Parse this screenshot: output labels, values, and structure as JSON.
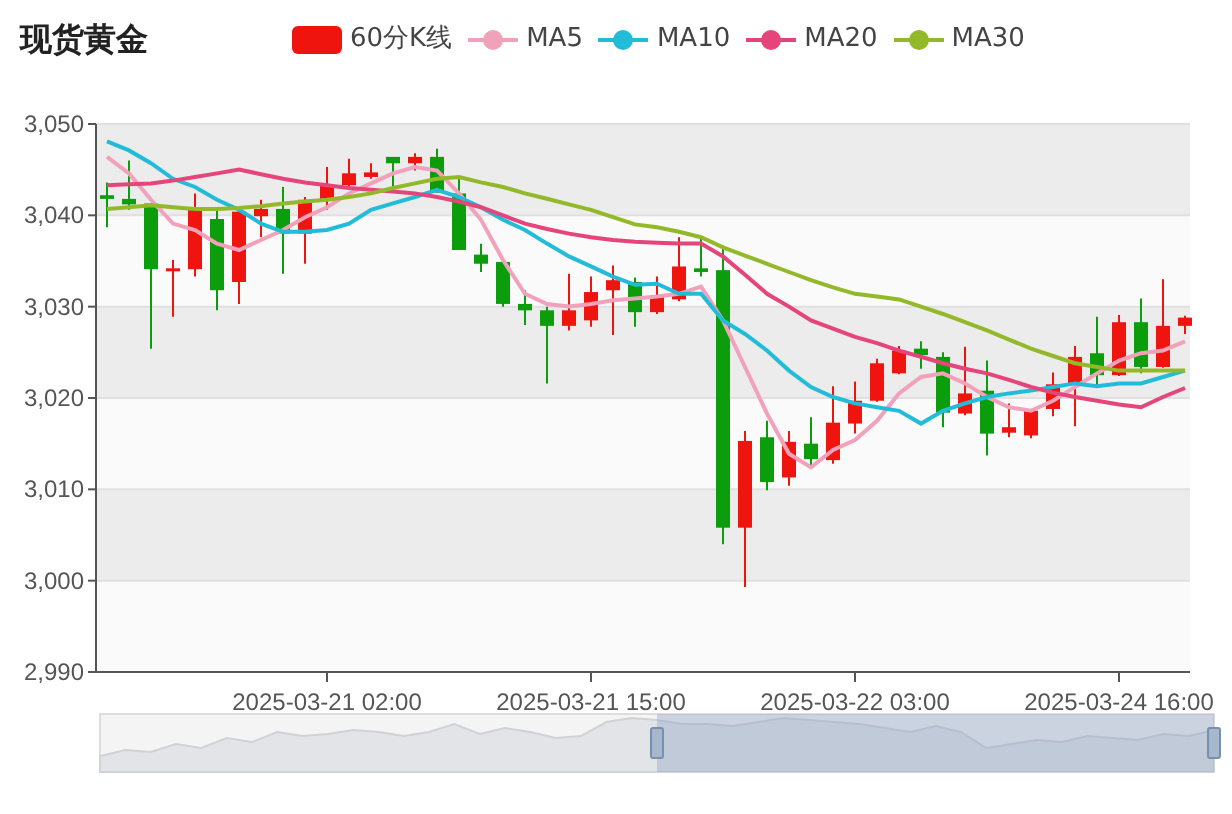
{
  "title": "现货黄金",
  "chart_data": {
    "type": "candlestick",
    "grid": true,
    "ylim": [
      2990,
      3050
    ],
    "yticks": [
      {
        "value": 2990,
        "label": "2,990"
      },
      {
        "value": 3000,
        "label": "3,000"
      },
      {
        "value": 3010,
        "label": "3,010"
      },
      {
        "value": 3020,
        "label": "3,020"
      },
      {
        "value": 3030,
        "label": "3,030"
      },
      {
        "value": 3040,
        "label": "3,040"
      },
      {
        "value": 3050,
        "label": "3,050"
      }
    ],
    "categories": [
      null,
      null,
      null,
      null,
      null,
      null,
      null,
      null,
      null,
      null,
      "2025-03-21 02:00",
      null,
      null,
      null,
      null,
      null,
      null,
      null,
      null,
      null,
      null,
      null,
      "2025-03-21 15:00",
      null,
      null,
      null,
      null,
      null,
      null,
      null,
      null,
      null,
      null,
      null,
      "2025-03-22 03:00",
      null,
      null,
      null,
      null,
      null,
      null,
      null,
      null,
      null,
      null,
      null,
      "2025-03-24 16:00",
      null,
      null,
      null
    ],
    "series": [
      {
        "name": "60分K线",
        "type": "candlestick",
        "colors": [
          "#0c9d0c",
          "#0c9d0c",
          "#0c9d0c",
          "#f0140f",
          "#f0140f",
          "#0c9d0c",
          "#f0140f",
          "#f0140f",
          "#0c9d0c",
          "#f0140f",
          "#f0140f",
          "#f0140f",
          "#f0140f",
          "#0c9d0c",
          "#f0140f",
          "#0c9d0c",
          "#0c9d0c",
          "#0c9d0c",
          "#0c9d0c",
          "#0c9d0c",
          "#0c9d0c",
          "#f0140f",
          "#f0140f",
          "#f0140f",
          "#0c9d0c",
          "#f0140f",
          "#f0140f",
          "#0c9d0c",
          "#0c9d0c",
          "#f0140f",
          "#0c9d0c",
          "#f0140f",
          "#0c9d0c",
          "#f0140f",
          "#f0140f",
          "#f0140f",
          "#f0140f",
          "#0c9d0c",
          "#0c9d0c",
          "#f0140f",
          "#0c9d0c",
          "#f0140f",
          "#f0140f",
          "#f0140f",
          "#f0140f",
          "#0c9d0c",
          "#f0140f",
          "#0c9d0c",
          "#f0140f",
          "#f0140f"
        ],
        "ohlc": [
          [
            3042.2,
            3043.6,
            3038.7,
            3041.8
          ],
          [
            3041.8,
            3046.0,
            3040.6,
            3041.2
          ],
          [
            3041.3,
            3041.3,
            3025.4,
            3034.1
          ],
          [
            3033.9,
            3035.1,
            3028.9,
            3034.2
          ],
          [
            3034.1,
            3042.4,
            3033.3,
            3040.8
          ],
          [
            3039.6,
            3040.6,
            3029.6,
            3031.8
          ],
          [
            3032.7,
            3040.9,
            3030.3,
            3040.4
          ],
          [
            3039.9,
            3041.7,
            3037.6,
            3040.7
          ],
          [
            3040.7,
            3043.1,
            3033.6,
            3038.0
          ],
          [
            3038.0,
            3042.0,
            3034.7,
            3041.7
          ],
          [
            3041.7,
            3045.3,
            3040.6,
            3043.3
          ],
          [
            3043.3,
            3046.2,
            3043.1,
            3044.6
          ],
          [
            3044.2,
            3045.7,
            3044.0,
            3044.7
          ],
          [
            3046.4,
            3046.4,
            3043.1,
            3045.7
          ],
          [
            3045.7,
            3046.8,
            3044.9,
            3046.4
          ],
          [
            3046.4,
            3047.3,
            3042.5,
            3042.5
          ],
          [
            3042.4,
            3044.2,
            3036.2,
            3036.2
          ],
          [
            3035.7,
            3036.9,
            3033.8,
            3034.7
          ],
          [
            3034.9,
            3035.1,
            3030.0,
            3030.3
          ],
          [
            3030.3,
            3031.8,
            3028.0,
            3029.6
          ],
          [
            3029.6,
            3030.0,
            3021.6,
            3027.9
          ],
          [
            3027.9,
            3033.6,
            3027.4,
            3029.6
          ],
          [
            3028.5,
            3033.3,
            3027.8,
            3031.6
          ],
          [
            3031.8,
            3034.5,
            3026.9,
            3032.9
          ],
          [
            3032.7,
            3033.2,
            3027.8,
            3029.4
          ],
          [
            3029.4,
            3033.3,
            3029.2,
            3031.1
          ],
          [
            3030.8,
            3037.6,
            3030.6,
            3034.4
          ],
          [
            3034.2,
            3037.6,
            3033.3,
            3033.8
          ],
          [
            3034.0,
            3036.7,
            3004.0,
            3005.8
          ],
          [
            3005.8,
            3016.4,
            2999.3,
            3015.3
          ],
          [
            3015.7,
            3017.5,
            3009.9,
            3010.8
          ],
          [
            3011.3,
            3016.4,
            3010.4,
            3015.2
          ],
          [
            3015.0,
            3017.9,
            3012.6,
            3013.3
          ],
          [
            3013.2,
            3021.3,
            3012.8,
            3017.3
          ],
          [
            3017.2,
            3021.8,
            3016.1,
            3019.7
          ],
          [
            3019.7,
            3024.3,
            3019.6,
            3023.8
          ],
          [
            3022.7,
            3025.7,
            3022.6,
            3025.2
          ],
          [
            3025.4,
            3026.2,
            3023.2,
            3024.7
          ],
          [
            3024.5,
            3025.0,
            3016.8,
            3018.4
          ],
          [
            3018.3,
            3025.6,
            3018.1,
            3020.5
          ],
          [
            3020.8,
            3024.1,
            3013.7,
            3016.1
          ],
          [
            3016.2,
            3019.4,
            3015.7,
            3016.8
          ],
          [
            3015.9,
            3018.8,
            3015.6,
            3018.6
          ],
          [
            3018.8,
            3022.8,
            3018.0,
            3021.5
          ],
          [
            3021.5,
            3025.7,
            3016.9,
            3024.5
          ],
          [
            3024.9,
            3028.9,
            3021.1,
            3022.5
          ],
          [
            3022.5,
            3029.1,
            3022.4,
            3028.3
          ],
          [
            3028.3,
            3030.9,
            3022.7,
            3023.4
          ],
          [
            3023.4,
            3033.0,
            3023.3,
            3027.9
          ],
          [
            3027.9,
            3029.0,
            3027.0,
            3028.8
          ]
        ]
      },
      {
        "name": "MA5",
        "type": "line",
        "color": "#f2a1bb",
        "values": [
          3046.4,
          3044.6,
          3041.7,
          3039.1,
          3038.4,
          3036.9,
          3036.2,
          3037.3,
          3038.4,
          3039.8,
          3040.9,
          3042.4,
          3043.5,
          3044.6,
          3045.3,
          3044.9,
          3042.4,
          3039.5,
          3035.1,
          3031.4,
          3030.3,
          3030.0,
          3030.3,
          3030.7,
          3030.9,
          3031.1,
          3031.4,
          3032.2,
          3028.5,
          3023.4,
          3018.3,
          3013.9,
          3012.4,
          3014.3,
          3015.4,
          3017.5,
          3020.5,
          3022.3,
          3022.7,
          3021.6,
          3020.1,
          3019.0,
          3018.6,
          3019.7,
          3021.2,
          3022.7,
          3024.1,
          3024.9,
          3025.2,
          3026.2
        ]
      },
      {
        "name": "MA10",
        "type": "line",
        "color": "#22bcd8",
        "values": [
          3048.1,
          3047.1,
          3045.7,
          3044.0,
          3043.1,
          3041.7,
          3040.6,
          3039.1,
          3038.2,
          3038.2,
          3038.4,
          3039.1,
          3040.6,
          3041.3,
          3042.0,
          3042.8,
          3042.0,
          3040.9,
          3039.5,
          3038.4,
          3036.9,
          3035.5,
          3034.4,
          3033.3,
          3032.4,
          3032.5,
          3031.4,
          3031.4,
          3028.5,
          3027.0,
          3025.2,
          3023.0,
          3021.2,
          3020.1,
          3019.4,
          3019.0,
          3018.6,
          3017.2,
          3018.6,
          3019.4,
          3020.1,
          3020.5,
          3020.8,
          3021.2,
          3021.6,
          3021.3,
          3021.6,
          3021.6,
          3022.3,
          3023.0
        ]
      },
      {
        "name": "MA20",
        "type": "line",
        "color": "#e5457a",
        "values": [
          3043.3,
          3043.4,
          3043.5,
          3043.8,
          3044.2,
          3044.6,
          3045.0,
          3044.5,
          3044.0,
          3043.6,
          3043.3,
          3043.0,
          3042.8,
          3042.6,
          3042.4,
          3042.0,
          3041.5,
          3040.9,
          3040.0,
          3039.1,
          3038.5,
          3038.0,
          3037.6,
          3037.3,
          3037.1,
          3037.0,
          3036.9,
          3036.9,
          3035.5,
          3033.5,
          3031.4,
          3030.0,
          3028.5,
          3027.6,
          3026.7,
          3026.0,
          3025.2,
          3024.5,
          3023.8,
          3023.2,
          3022.7,
          3022.0,
          3021.2,
          3020.6,
          3020.1,
          3019.7,
          3019.3,
          3019.0,
          3020.1,
          3021.1
        ]
      },
      {
        "name": "MA30",
        "type": "line",
        "color": "#93b82a",
        "values": [
          3040.7,
          3040.9,
          3041.1,
          3040.9,
          3040.7,
          3040.7,
          3040.8,
          3041.0,
          3041.3,
          3041.5,
          3041.7,
          3042.0,
          3042.4,
          3043.0,
          3043.5,
          3044.0,
          3044.2,
          3043.6,
          3043.1,
          3042.4,
          3041.8,
          3041.2,
          3040.6,
          3039.8,
          3039.0,
          3038.7,
          3038.2,
          3037.6,
          3036.5,
          3035.6,
          3034.7,
          3033.8,
          3032.9,
          3032.1,
          3031.4,
          3031.1,
          3030.8,
          3030.0,
          3029.2,
          3028.3,
          3027.4,
          3026.4,
          3025.4,
          3024.6,
          3023.8,
          3023.4,
          3023.0,
          3023.0,
          3023.0,
          3023.0
        ]
      }
    ]
  },
  "zoom_slider": {
    "level": 0.5
  }
}
